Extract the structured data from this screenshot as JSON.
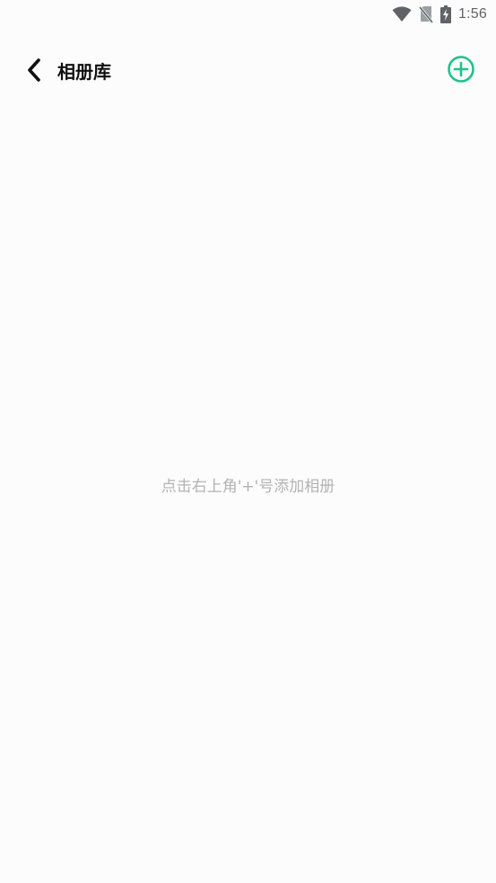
{
  "status_bar": {
    "time": "1:56",
    "icons": [
      "wifi-icon",
      "no-sim-icon",
      "battery-charging-icon"
    ]
  },
  "header": {
    "back_icon": "chevron-left-icon",
    "title": "相册库",
    "add_icon": "plus-circle-icon",
    "accent_color": "#1fc38a"
  },
  "main": {
    "empty_hint": "点击右上角'+'号添加相册"
  },
  "colors": {
    "background": "#fcfcfc",
    "title": "#111111",
    "hint": "#b3b3b3",
    "status": "#5f6368"
  }
}
